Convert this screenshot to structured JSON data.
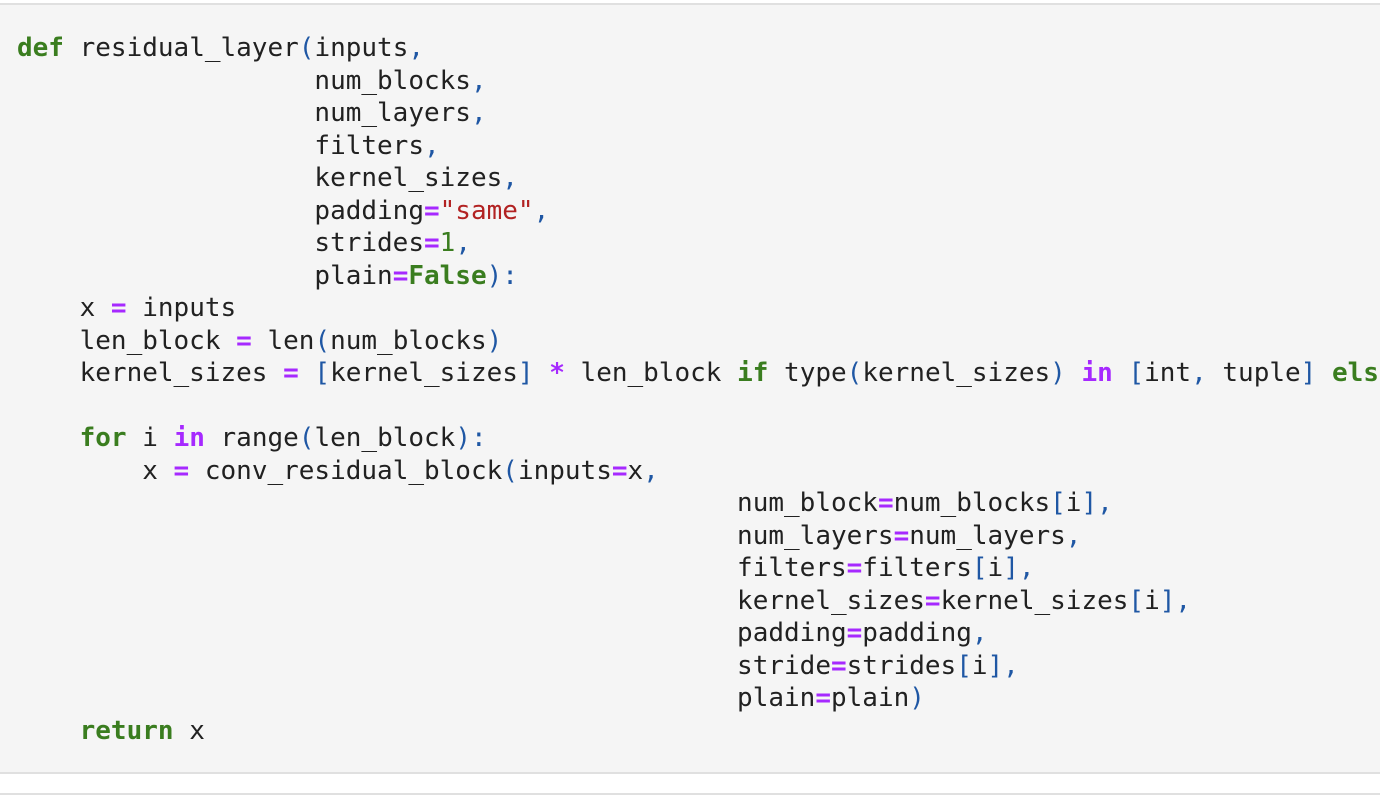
{
  "code_lines": [
    [
      [
        "kw",
        "def"
      ],
      [
        "t",
        " residual_layer"
      ],
      [
        "p",
        "("
      ],
      [
        "t",
        "inputs"
      ],
      [
        "p",
        ","
      ]
    ],
    [
      [
        "t",
        "                   num_blocks"
      ],
      [
        "p",
        ","
      ]
    ],
    [
      [
        "t",
        "                   num_layers"
      ],
      [
        "p",
        ","
      ]
    ],
    [
      [
        "t",
        "                   filters"
      ],
      [
        "p",
        ","
      ]
    ],
    [
      [
        "t",
        "                   kernel_sizes"
      ],
      [
        "p",
        ","
      ]
    ],
    [
      [
        "t",
        "                   padding"
      ],
      [
        "op",
        "="
      ],
      [
        "s",
        "\"same\""
      ],
      [
        "p",
        ","
      ]
    ],
    [
      [
        "t",
        "                   strides"
      ],
      [
        "op",
        "="
      ],
      [
        "n",
        "1"
      ],
      [
        "p",
        ","
      ]
    ],
    [
      [
        "t",
        "                   plain"
      ],
      [
        "op",
        "="
      ],
      [
        "kw",
        "False"
      ],
      [
        "p",
        "):"
      ]
    ],
    [
      [
        "t",
        "    x "
      ],
      [
        "op",
        "="
      ],
      [
        "t",
        " inputs"
      ]
    ],
    [
      [
        "t",
        "    len_block "
      ],
      [
        "op",
        "="
      ],
      [
        "t",
        " len"
      ],
      [
        "p",
        "("
      ],
      [
        "t",
        "num_blocks"
      ],
      [
        "p",
        ")"
      ]
    ],
    [
      [
        "t",
        "    kernel_sizes "
      ],
      [
        "op",
        "="
      ],
      [
        "t",
        " "
      ],
      [
        "p",
        "["
      ],
      [
        "t",
        "kernel_sizes"
      ],
      [
        "p",
        "]"
      ],
      [
        "t",
        " "
      ],
      [
        "op",
        "*"
      ],
      [
        "t",
        " len_block "
      ],
      [
        "kw",
        "if"
      ],
      [
        "t",
        " type"
      ],
      [
        "p",
        "("
      ],
      [
        "t",
        "kernel_sizes"
      ],
      [
        "p",
        ")"
      ],
      [
        "t",
        " "
      ],
      [
        "op",
        "in"
      ],
      [
        "t",
        " "
      ],
      [
        "p",
        "["
      ],
      [
        "t",
        "int"
      ],
      [
        "p",
        ","
      ],
      [
        "t",
        " tuple"
      ],
      [
        "p",
        "]"
      ],
      [
        "t",
        " "
      ],
      [
        "kw",
        "else"
      ]
    ],
    [],
    [
      [
        "t",
        "    "
      ],
      [
        "kw",
        "for"
      ],
      [
        "t",
        " i "
      ],
      [
        "op",
        "in"
      ],
      [
        "t",
        " range"
      ],
      [
        "p",
        "("
      ],
      [
        "t",
        "len_block"
      ],
      [
        "p",
        "):"
      ]
    ],
    [
      [
        "t",
        "        x "
      ],
      [
        "op",
        "="
      ],
      [
        "t",
        " conv_residual_block"
      ],
      [
        "p",
        "("
      ],
      [
        "t",
        "inputs"
      ],
      [
        "op",
        "="
      ],
      [
        "t",
        "x"
      ],
      [
        "p",
        ","
      ]
    ],
    [
      [
        "t",
        "                                              num_block"
      ],
      [
        "op",
        "="
      ],
      [
        "t",
        "num_blocks"
      ],
      [
        "p",
        "["
      ],
      [
        "t",
        "i"
      ],
      [
        "p",
        "],"
      ]
    ],
    [
      [
        "t",
        "                                              num_layers"
      ],
      [
        "op",
        "="
      ],
      [
        "t",
        "num_layers"
      ],
      [
        "p",
        ","
      ]
    ],
    [
      [
        "t",
        "                                              filters"
      ],
      [
        "op",
        "="
      ],
      [
        "t",
        "filters"
      ],
      [
        "p",
        "["
      ],
      [
        "t",
        "i"
      ],
      [
        "p",
        "],"
      ]
    ],
    [
      [
        "t",
        "                                              kernel_sizes"
      ],
      [
        "op",
        "="
      ],
      [
        "t",
        "kernel_sizes"
      ],
      [
        "p",
        "["
      ],
      [
        "t",
        "i"
      ],
      [
        "p",
        "],"
      ]
    ],
    [
      [
        "t",
        "                                              padding"
      ],
      [
        "op",
        "="
      ],
      [
        "t",
        "padding"
      ],
      [
        "p",
        ","
      ]
    ],
    [
      [
        "t",
        "                                              stride"
      ],
      [
        "op",
        "="
      ],
      [
        "t",
        "strides"
      ],
      [
        "p",
        "["
      ],
      [
        "t",
        "i"
      ],
      [
        "p",
        "],"
      ]
    ],
    [
      [
        "t",
        "                                              plain"
      ],
      [
        "op",
        "="
      ],
      [
        "t",
        "plain"
      ],
      [
        "p",
        ")"
      ]
    ],
    [
      [
        "t",
        "    "
      ],
      [
        "kw",
        "return"
      ],
      [
        "t",
        " x"
      ]
    ]
  ]
}
